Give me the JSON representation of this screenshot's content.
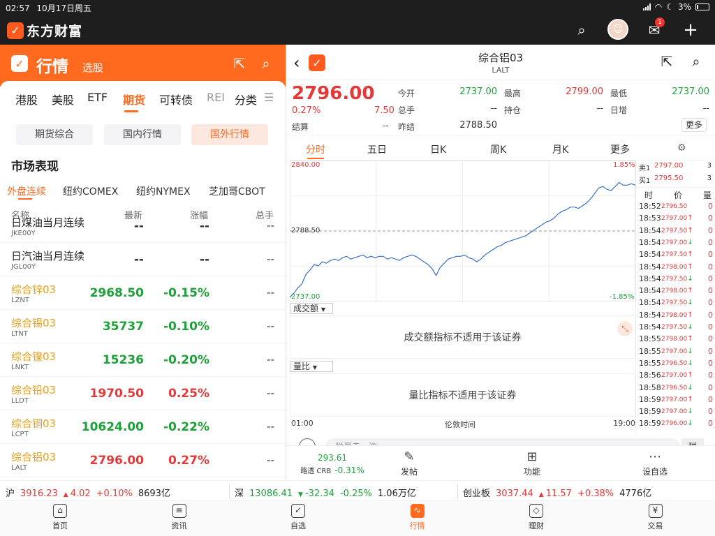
{
  "status": {
    "time": "02:57",
    "date": "10月17日周五",
    "battery": "3%"
  },
  "app": {
    "brand": "东方财富",
    "mail_badge": "1"
  },
  "left": {
    "title": "行情",
    "subtitle": "选股",
    "tabs": [
      "港股",
      "美股",
      "ETF",
      "期货",
      "可转债",
      "REI",
      "分类"
    ],
    "active_tab": 3,
    "subtabs": [
      "期货综合",
      "国内行情",
      "国外行情"
    ],
    "active_subtab": 2,
    "section_title": "市场表现",
    "market_tabs": [
      "外盘连续",
      "纽约COMEX",
      "纽约NYMEX",
      "芝加哥CBOT"
    ],
    "active_market_tab": 0,
    "columns": {
      "name": "名称",
      "price": "最新",
      "change": "涨幅",
      "total": "总手"
    },
    "rows": [
      {
        "name": "日煤油当月连续",
        "code": "JKE00Y",
        "price": "--",
        "change": "--",
        "total": "--",
        "dir": "nt",
        "hl": false
      },
      {
        "name": "日汽油当月连续",
        "code": "JGL00Y",
        "price": "--",
        "change": "--",
        "total": "--",
        "dir": "nt",
        "hl": false
      },
      {
        "name": "综合锌03",
        "code": "LZNT",
        "price": "2968.50",
        "change": "-0.15%",
        "total": "--",
        "dir": "dn",
        "hl": true
      },
      {
        "name": "综合锡03",
        "code": "LTNT",
        "price": "35737",
        "change": "-0.10%",
        "total": "--",
        "dir": "dn",
        "hl": true
      },
      {
        "name": "综合镍03",
        "code": "LNKT",
        "price": "15236",
        "change": "-0.20%",
        "total": "--",
        "dir": "dn",
        "hl": true
      },
      {
        "name": "综合铅03",
        "code": "LLDT",
        "price": "1970.50",
        "change": "0.25%",
        "total": "--",
        "dir": "up",
        "hl": true
      },
      {
        "name": "综合铜03",
        "code": "LCPT",
        "price": "10624.00",
        "change": "-0.22%",
        "total": "--",
        "dir": "dn",
        "hl": true
      },
      {
        "name": "综合铝03",
        "code": "LALT",
        "price": "2796.00",
        "change": "0.27%",
        "total": "--",
        "dir": "up",
        "hl": true
      }
    ]
  },
  "detail": {
    "name": "综合铝03",
    "code": "LALT",
    "last": "2796.00",
    "pct": "0.27%",
    "chg": "7.50",
    "settle_label": "结算",
    "settle": "--",
    "fields": [
      {
        "label": "今开",
        "value": "2737.00",
        "dir": "dn"
      },
      {
        "label": "最高",
        "value": "2799.00",
        "dir": "up"
      },
      {
        "label": "最低",
        "value": "2737.00",
        "dir": "dn"
      },
      {
        "label": "总手",
        "value": "--",
        "dir": "nt"
      },
      {
        "label": "持仓",
        "value": "--",
        "dir": "nt"
      },
      {
        "label": "日增",
        "value": "--",
        "dir": "nt"
      },
      {
        "label": "昨结",
        "value": "2788.50",
        "dir": "nt"
      }
    ],
    "more": "更多",
    "periods": [
      "分时",
      "五日",
      "日K",
      "周K",
      "月K",
      "更多"
    ],
    "active_period": 0,
    "chart": {
      "ymax_label": "2840.00",
      "ymin_label": "2737.00",
      "ymid_label": "2788.50",
      "pmax_label": "1.85%",
      "pmin_label": "-1.85%",
      "ymin": 2737.0,
      "ymax": 2840.0,
      "prev": 2788.5,
      "values": [
        2740,
        2743,
        2747,
        2750,
        2757,
        2760,
        2764,
        2763,
        2766,
        2765,
        2767,
        2768,
        2767,
        2769,
        2770,
        2768,
        2769,
        2770,
        2771,
        2769,
        2770,
        2769,
        2770,
        2770,
        2768,
        2769,
        2768,
        2767,
        2769,
        2770,
        2771,
        2770,
        2768,
        2766,
        2764,
        2761,
        2756,
        2762,
        2765,
        2768,
        2769,
        2770,
        2770,
        2771,
        2769,
        2768,
        2766,
        2768,
        2771,
        2773,
        2775,
        2777,
        2778,
        2780,
        2781,
        2782,
        2783,
        2784,
        2785,
        2787,
        2789,
        2791,
        2793,
        2795,
        2796,
        2798,
        2801,
        2803,
        2804,
        2806,
        2806,
        2805,
        2807,
        2809,
        2812,
        2816,
        2820,
        2821,
        2819,
        2818,
        2821,
        2824,
        2822,
        2822,
        2823,
        2822
      ],
      "x_start": "01:00",
      "x_mid": "伦敦时间",
      "x_end": "19:00"
    },
    "volume_label": "成交额",
    "volume_msg": "成交额指标不适用于该证券",
    "ratio_label": "量比",
    "ratio_msg": "量比指标不适用于该证券",
    "sell1": {
      "label": "卖1",
      "price": "2797.00",
      "vol": "3"
    },
    "buy1": {
      "label": "买1",
      "price": "2795.50",
      "vol": "3"
    },
    "tick_header": {
      "time": "时",
      "price": "价",
      "vol": "量"
    },
    "ticks": [
      {
        "t": "18:52",
        "p": "2796.50",
        "d": "up",
        "a": "",
        "v": "0"
      },
      {
        "t": "18:53",
        "p": "2797.00",
        "d": "up",
        "a": "↑",
        "v": "0"
      },
      {
        "t": "18:54",
        "p": "2797.50",
        "d": "up",
        "a": "↑",
        "v": "0"
      },
      {
        "t": "18:54",
        "p": "2797.00",
        "d": "up",
        "a": "↓",
        "v": "0"
      },
      {
        "t": "18:54",
        "p": "2797.50",
        "d": "up",
        "a": "↑",
        "v": "0"
      },
      {
        "t": "18:54",
        "p": "2798.00",
        "d": "up",
        "a": "↑",
        "v": "0"
      },
      {
        "t": "18:54",
        "p": "2797.50",
        "d": "up",
        "a": "↓",
        "v": "0"
      },
      {
        "t": "18:54",
        "p": "2798.00",
        "d": "up",
        "a": "↑",
        "v": "0"
      },
      {
        "t": "18:54",
        "p": "2797.50",
        "d": "up",
        "a": "↓",
        "v": "0"
      },
      {
        "t": "18:54",
        "p": "2798.00",
        "d": "up",
        "a": "↑",
        "v": "0"
      },
      {
        "t": "18:54",
        "p": "2797.50",
        "d": "up",
        "a": "↓",
        "v": "0"
      },
      {
        "t": "18:55",
        "p": "2798.00",
        "d": "up",
        "a": "↑",
        "v": "0"
      },
      {
        "t": "18:55",
        "p": "2797.00",
        "d": "up",
        "a": "↓",
        "v": "0"
      },
      {
        "t": "18:55",
        "p": "2796.50",
        "d": "up",
        "a": "↓",
        "v": "0"
      },
      {
        "t": "18:56",
        "p": "2797.00",
        "d": "up",
        "a": "↑",
        "v": "0"
      },
      {
        "t": "18:58",
        "p": "2796.50",
        "d": "up",
        "a": "↓",
        "v": "0"
      },
      {
        "t": "18:59",
        "p": "2797.00",
        "d": "up",
        "a": "↑",
        "v": "0"
      },
      {
        "t": "18:59",
        "p": "2797.00",
        "d": "up",
        "a": "↓",
        "v": "0"
      },
      {
        "t": "18:59",
        "p": "2796.00",
        "d": "up",
        "a": "↓",
        "v": "0"
      }
    ],
    "comment_placeholder": "弹幕走一波",
    "comment_btn": "弹",
    "mini_index": {
      "value": "293.61",
      "name": "路透 CRB",
      "change": "-0.31%"
    },
    "actions": [
      {
        "label": "发帖",
        "icon": "✎"
      },
      {
        "label": "功能",
        "icon": "⊞"
      },
      {
        "label": "设自选",
        "icon": "⋯"
      }
    ]
  },
  "indices": [
    {
      "name": "沪",
      "value": "3916.23",
      "arrow": "▲",
      "chg": "4.02",
      "pct": "+0.10%",
      "amt": "8693亿",
      "dir": "up"
    },
    {
      "name": "深",
      "value": "13086.41",
      "arrow": "▼",
      "chg": "-32.34",
      "pct": "-0.25%",
      "amt": "1.06万亿",
      "dir": "dn"
    },
    {
      "name": "创业板",
      "value": "3037.44",
      "arrow": "▲",
      "chg": "11.57",
      "pct": "+0.38%",
      "amt": "4776亿",
      "dir": "up"
    }
  ],
  "nav": [
    {
      "label": "首页",
      "icon": "⌂"
    },
    {
      "label": "资讯",
      "icon": "≡"
    },
    {
      "label": "自选",
      "icon": "✓"
    },
    {
      "label": "行情",
      "icon": "∿"
    },
    {
      "label": "理财",
      "icon": "◇"
    },
    {
      "label": "交易",
      "icon": "¥"
    }
  ],
  "active_nav": 3,
  "colors": {
    "brand": "#ff6a1f",
    "up": "#e23a3a",
    "down": "#1ea13a",
    "line": "#3b6fc4"
  }
}
